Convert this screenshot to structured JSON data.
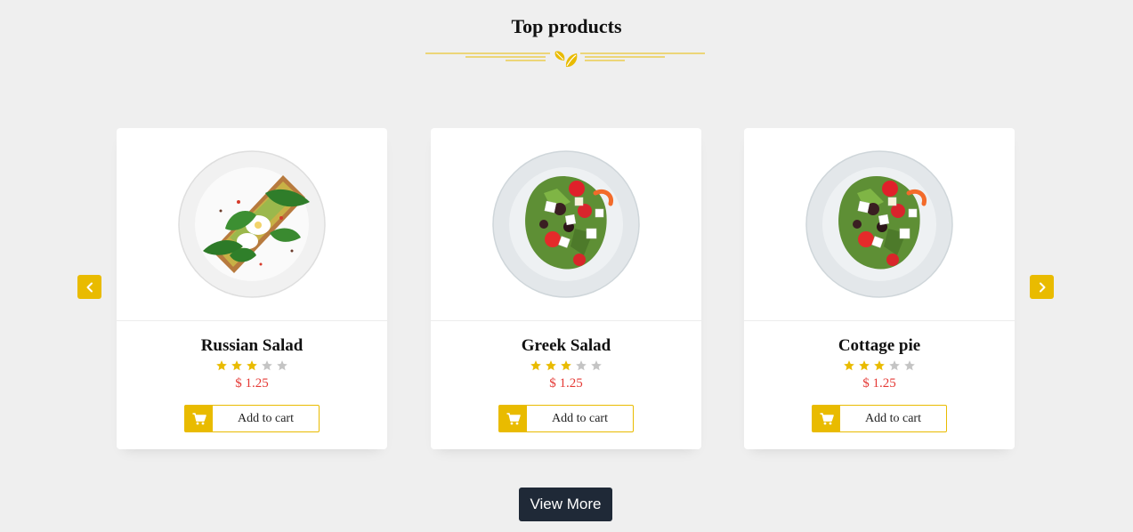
{
  "section": {
    "title": "Top products"
  },
  "colors": {
    "accent": "#e9bb00",
    "price": "#e53935",
    "dark_button": "#1f2937",
    "background": "#efefef"
  },
  "carousel": {
    "prev_icon": "chevron-left-icon",
    "next_icon": "chevron-right-icon"
  },
  "products": [
    {
      "name": "Russian Salad",
      "rating": 3,
      "max_rating": 5,
      "price": "$ 1.25",
      "button_label": "Add to cart",
      "image": "avocado-toast-plate"
    },
    {
      "name": "Greek Salad",
      "rating": 3,
      "max_rating": 5,
      "price": "$ 1.25",
      "button_label": "Add to cart",
      "image": "greek-salad-plate"
    },
    {
      "name": "Cottage pie",
      "rating": 3,
      "max_rating": 5,
      "price": "$ 1.25",
      "button_label": "Add to cart",
      "image": "greek-salad-plate"
    }
  ],
  "view_more": {
    "label": "View More"
  }
}
